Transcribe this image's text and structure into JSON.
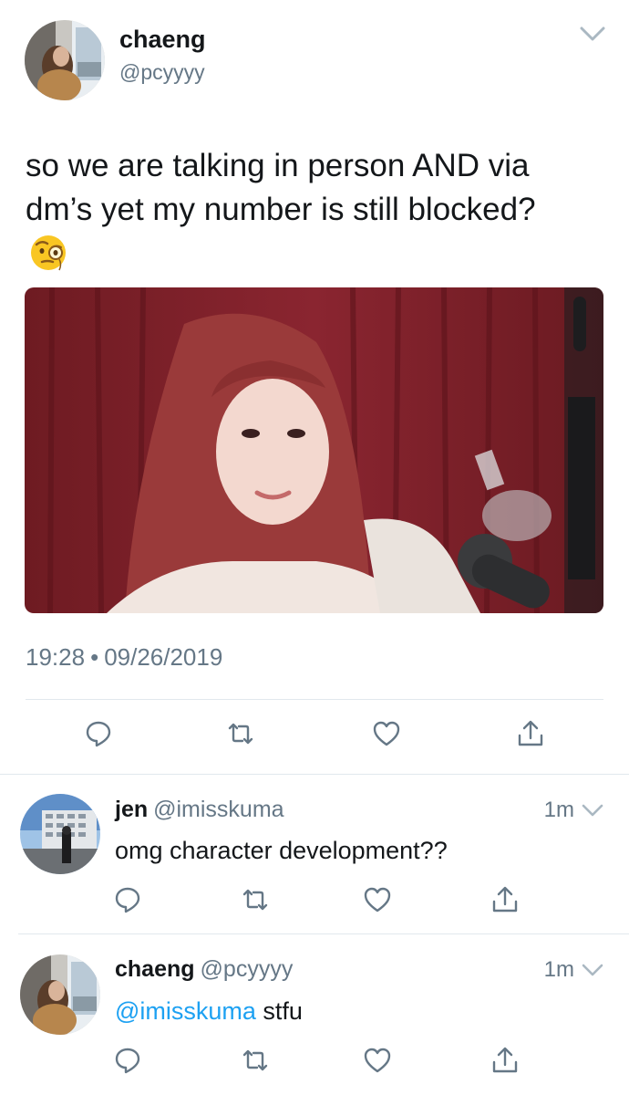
{
  "tweet": {
    "display_name": "chaeng",
    "handle": "@pcyyyy",
    "text_line1": "so we are talking in person AND via",
    "text_line2": "dm’s yet my number is still blocked?",
    "emoji": "face-with-monocle",
    "time": "19:28",
    "separator": "•",
    "date": "09/26/2019"
  },
  "replies": [
    {
      "display_name": "jen",
      "handle": "@imisskuma",
      "age": "1m",
      "text": "omg character development??"
    },
    {
      "display_name": "chaeng",
      "handle": "@pcyyyy",
      "age": "1m",
      "mention": "@imisskuma",
      "text": " stfu"
    }
  ],
  "icons": [
    "reply-icon",
    "retweet-icon",
    "like-icon",
    "share-icon",
    "chevron-down-icon"
  ],
  "colors": {
    "text": "#14171a",
    "secondary": "#657786",
    "link": "#1da1f2",
    "divider": "#e1e8ed"
  }
}
